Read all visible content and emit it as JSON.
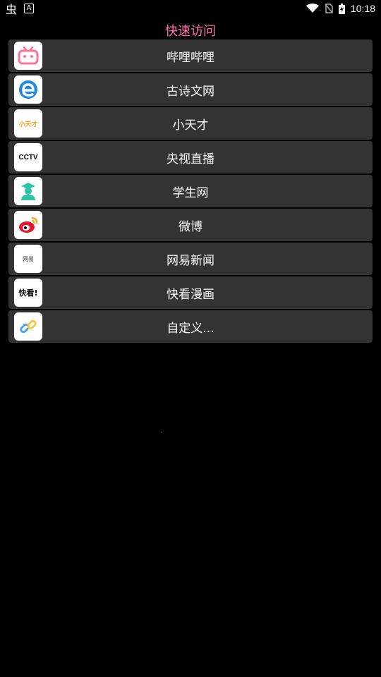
{
  "statusbar": {
    "app_glyph": "虫",
    "notif_glyph": "A",
    "time": "10:18"
  },
  "title": "快速访问",
  "items": [
    {
      "label": "哔哩哔哩",
      "icon": "bilibili-icon",
      "accent": "#fb7299"
    },
    {
      "label": "古诗文网",
      "icon": "edge-browser-icon",
      "accent": "#1e88e5"
    },
    {
      "label": "小天才",
      "icon": "xiaotiancai-icon",
      "accent": "#f5a623",
      "logo_text": "小天才"
    },
    {
      "label": "央视直播",
      "icon": "cctv-icon",
      "accent": "#000000",
      "logo_text": "CCTV"
    },
    {
      "label": "学生网",
      "icon": "student-icon",
      "accent": "#2ec4a6"
    },
    {
      "label": "微博",
      "icon": "weibo-icon",
      "accent": "#e6162d"
    },
    {
      "label": "网易新闻",
      "icon": "netease-news-icon",
      "accent": "#333333",
      "logo_text": "网易"
    },
    {
      "label": "快看漫画",
      "icon": "kuaikan-icon",
      "accent": "#000000",
      "logo_text": "快看!"
    },
    {
      "label": "自定义...",
      "icon": "link-icon",
      "accent": "#4aa3f0"
    }
  ]
}
